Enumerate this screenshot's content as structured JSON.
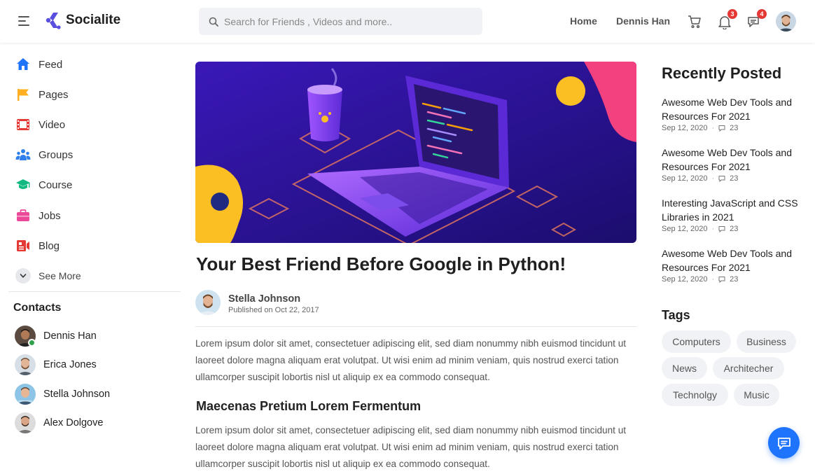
{
  "header": {
    "app_name": "Socialite",
    "search_placeholder": "Search for Friends , Videos and more..",
    "nav": [
      "Home",
      "Dennis Han"
    ],
    "notification_count": "3",
    "message_count": "4",
    "icons": [
      "menu-icon",
      "cart-icon",
      "bell-icon",
      "message-icon"
    ]
  },
  "sidebar": {
    "items": [
      {
        "label": "Feed",
        "icon": "home-icon",
        "color": "#1e74fd"
      },
      {
        "label": "Pages",
        "icon": "flag-icon",
        "color": "#ffb020"
      },
      {
        "label": "Video",
        "icon": "video-icon",
        "color": "#e53935"
      },
      {
        "label": "Groups",
        "icon": "groups-icon",
        "color": "#2f80ed"
      },
      {
        "label": "Course",
        "icon": "graduation-cap-icon",
        "color": "#10b981"
      },
      {
        "label": "Jobs",
        "icon": "briefcase-icon",
        "color": "#ec4899"
      },
      {
        "label": "Blog",
        "icon": "blog-icon",
        "color": "#e53935"
      }
    ],
    "see_more": "See More",
    "contacts_title": "Contacts",
    "contacts": [
      {
        "name": "Dennis Han",
        "online": true
      },
      {
        "name": "Erica Jones",
        "online": false
      },
      {
        "name": "Stella Johnson",
        "online": false
      },
      {
        "name": "Alex Dolgove",
        "online": false
      }
    ]
  },
  "post": {
    "title": "Your Best Friend Before Google in Python!",
    "author": "Stella Johnson",
    "published": "Published on Oct 22, 2017",
    "paragraph1": "Lorem ipsum dolor sit amet, consectetuer adipiscing elit, sed diam nonummy nibh euismod tincidunt ut laoreet dolore magna aliquam erat volutpat. Ut wisi enim ad minim veniam, quis nostrud exerci tation ullamcorper suscipit lobortis nisl ut aliquip ex ea commodo consequat.",
    "subheading": "Maecenas Pretium Lorem Fermentum",
    "paragraph2": "Lorem ipsum dolor sit amet, consectetuer adipiscing elit, sed diam nonummy nibh euismod tincidunt ut laoreet dolore magna aliquam erat volutpat. Ut wisi enim ad minim veniam, quis nostrud exerci tation ullamcorper suscipit lobortis nisl ut aliquip ex ea commodo consequat."
  },
  "recent": {
    "title": "Recently Posted",
    "items": [
      {
        "title": "Awesome Web Dev Tools and Resources For 2021",
        "date": "Sep 12, 2020",
        "comments": "23"
      },
      {
        "title": "Awesome Web Dev Tools and Resources For 2021",
        "date": "Sep 12, 2020",
        "comments": "23"
      },
      {
        "title": "Interesting JavaScript and CSS Libraries in 2021",
        "date": "Sep 12, 2020",
        "comments": "23"
      },
      {
        "title": "Awesome Web Dev Tools and Resources For 2021",
        "date": "Sep 12, 2020",
        "comments": "23"
      }
    ]
  },
  "tags": {
    "title": "Tags",
    "items": [
      "Computers",
      "Business",
      "News",
      "Architecher",
      "Technolgy",
      "Music"
    ]
  },
  "colors": {
    "accent": "#1e74fd",
    "logo": "#5b4fe0",
    "badge": "#e53935",
    "online": "#31a24c"
  }
}
